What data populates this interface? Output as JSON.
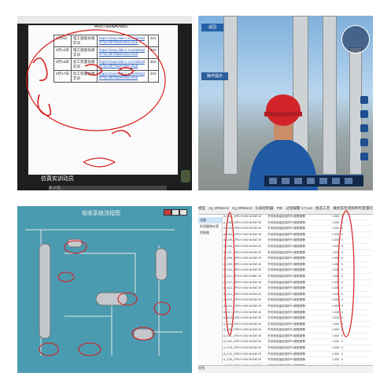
{
  "top_left": {
    "url_text": "Aubf&d&Avwbc",
    "rows": [
      {
        "date": "5月9日",
        "title": "电工基础仿真实训",
        "link": "https://www.ilab-x.com/details/?id=8070&isView=true",
        "num": "202"
      },
      {
        "date": "5月10日",
        "title": "电工基础仿真实训",
        "link": "https://www.ilab-x.com/details/?id=8070&isView=true",
        "num": "202"
      },
      {
        "date": "5月16日",
        "title": "化工装置仿真实训",
        "link": "https://www.ilab-x.com/details/?id=8070&isView=true",
        "num": "202"
      },
      {
        "date": "5月17日",
        "title": "化工装置仿真实训",
        "link": "https://www.ilab-x.com/details/?id=8070&isView=true",
        "num": "202"
      }
    ],
    "caption": "仿真实训动员",
    "pager": "共 10 页"
  },
  "top_right": {
    "label": "返回",
    "chip": "操作提示"
  },
  "bottom_left": {
    "title": "吸收系统流程图"
  },
  "bottom_right": {
    "tabs": [
      "模型",
      "mj_0RW4A2",
      "mj_0RW4A2",
      "仪表控制器",
      "PID",
      "过程报警 17,144",
      "组态工艺",
      "做状态检测和所有变量的检测"
    ],
    "side_items": [
      "设备",
      "检测器和仪表",
      "控制器"
    ],
    "rows": [
      {
        "id": "A_K01_OPD+0.000 NONE 09",
        "desc": "开关阀流量检测的PV超限报警",
        "val": "1.000",
        "st": "0"
      },
      {
        "id": "A_K02_OPD+0.000 NONE 09",
        "desc": "开关阀流量检测的PV超限报警",
        "val": "1.000",
        "st": "0"
      },
      {
        "id": "A_K03_OPD+0.000 NONE 09",
        "desc": "开关阀流量检测的PV超限报警",
        "val": "1.000",
        "st": "0"
      },
      {
        "id": "A_K04_OPD+0.000 NONE 09",
        "desc": "开关阀流量检测的PV超限报警",
        "val": "1.000",
        "st": "0"
      },
      {
        "id": "A_K05_OPD+0.000 NONE 09",
        "desc": "开关阀流量检测的PV超限报警",
        "val": "1.000",
        "st": "0"
      },
      {
        "id": "A_K06_OPD+0.000 NONE 09",
        "desc": "开关阀流量检测的PV超限报警",
        "val": "1.000",
        "st": "0"
      },
      {
        "id": "A_K07_OPD+0.000 NONE 09",
        "desc": "开关阀流量检测的PV超限报警",
        "val": "1.000",
        "st": "0"
      },
      {
        "id": "A_K08_OPD+0.000 NONE 09",
        "desc": "开关阀流量检测的PV超限报警",
        "val": "1.000",
        "st": "0"
      },
      {
        "id": "A_K09_OPD+0.000 NONE 09",
        "desc": "开关阀流量检测的PV超限报警",
        "val": "1.000",
        "st": "0"
      },
      {
        "id": "A_K10_OPD+0.000 NONE 09",
        "desc": "开关阀流量检测的PV超限报警",
        "val": "1.000",
        "st": "0"
      },
      {
        "id": "A_K11_OPD+0.000 NONE 09",
        "desc": "开关阀流量检测的PV超限报警",
        "val": "1.000",
        "st": "0"
      },
      {
        "id": "A_K12_OPD+0.000 NONE 09",
        "desc": "开关阀流量检测的PV超限报警",
        "val": "1.000",
        "st": "0"
      },
      {
        "id": "A_K13_OPD+0.000 NONE 09",
        "desc": "开关阀流量检测的PV超限报警",
        "val": "1.000",
        "st": "0"
      },
      {
        "id": "A_K14_OPD+0.000 NONE 09",
        "desc": "开关阀流量检测的PV超限报警",
        "val": "1.000",
        "st": "0"
      },
      {
        "id": "A_K15_OPD+0.000 NONE 09",
        "desc": "开关阀流量检测的PV超限报警",
        "val": "1.000",
        "st": "0"
      },
      {
        "id": "A_K16_OPD+0.000 NONE 09",
        "desc": "开关阀流量检测的PV超限报警",
        "val": "1.000",
        "st": "0"
      },
      {
        "id": "A_K17_OPD+0.000 NONE 09",
        "desc": "开关阀流量检测的PV超限报警",
        "val": "1.000",
        "st": "0"
      },
      {
        "id": "A_K18_OPD+0.000 NONE 09",
        "desc": "开关阀流量检测的PV超限报警",
        "val": "1.000",
        "st": "0"
      },
      {
        "id": "A_K19_OPD+0.000 NONE 09",
        "desc": "开关阀流量检测的PV超限报警",
        "val": "1.000",
        "st": "0"
      },
      {
        "id": "A_K20_OPD+0.000 NONE 09",
        "desc": "开关阀流量检测的PV超限报警",
        "val": "1.000",
        "st": "0"
      },
      {
        "id": "A_K21_OPD+0.000 NONE 09",
        "desc": "开关阀流量检测的PV超限报警",
        "val": "1.000",
        "st": "0"
      },
      {
        "id": "A_K22_OPD+0.000 NONE 09",
        "desc": "开关阀流量检测的PV超限报警",
        "val": "1.000",
        "st": "0"
      },
      {
        "id": "A_K23_OPD+0.000 NONE 09",
        "desc": "开关阀流量检测的PV超限报警",
        "val": "1.000",
        "st": "0"
      },
      {
        "id": "A_K24_OPD+0.000 NONE 09",
        "desc": "开关阀流量检测的PV超限报警",
        "val": "1.000",
        "st": "0"
      },
      {
        "id": "A_K25_OPD+0.000 NONE 09",
        "desc": "开关阀流量检测的PV超限报警",
        "val": "1.000",
        "st": "0"
      },
      {
        "id": "A_K26_OPD+0.000 NONE 09",
        "desc": "开关阀流量检测的PV超限报警",
        "val": "1.000",
        "st": "0"
      },
      {
        "id": "A_K27_OPD+0.000 NONE 09",
        "desc": "开关阀流量检测的PV超限报警",
        "val": "1.000",
        "st": "0"
      },
      {
        "id": "A_K28_OPD+0.000 NONE 09",
        "desc": "开关阀流量检测的PV超限报警",
        "val": "0.000",
        "st": "0"
      },
      {
        "id": "A_K29_OPD+0.000 NONE 09",
        "desc": "开关阀流量检测的PV超限报警",
        "val": "0.000",
        "st": "0"
      }
    ],
    "status": "就绪"
  },
  "colors": {
    "annotation_red": "#d81e1e",
    "annotation_orange": "#e68a00",
    "bl_background": "#4a9bb0",
    "pipe": "#7a2e2e"
  }
}
